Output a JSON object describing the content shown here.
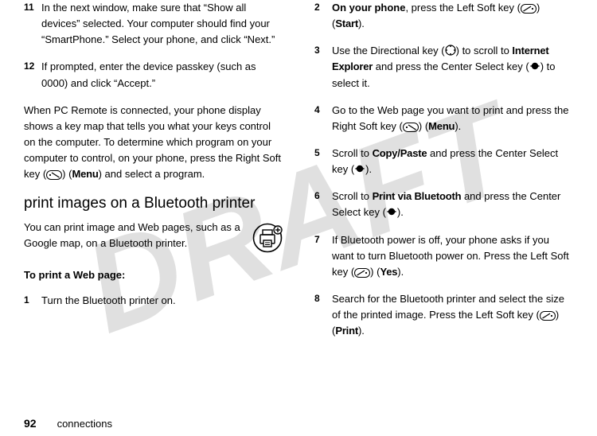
{
  "watermark": "DRAFT",
  "left": {
    "step11": {
      "num": "11",
      "text_a": "In the next window, make sure that “Show all devices” selected. Your computer should find your “SmartPhone.” Select your phone, and click “Next.”"
    },
    "step12": {
      "num": "12",
      "text_a": "If prompted, enter the device passkey (such as 0000) and click “Accept.”"
    },
    "para1_a": "When PC Remote is connected, your phone display shows a key map that tells you what your keys control on the computer. To determine which program on your computer to control, on your phone, press the Right Soft key (",
    "para1_b": ") (",
    "para1_menu": "Menu",
    "para1_c": ") and select a program.",
    "heading": "print images on a Bluetooth printer",
    "intro": "You can print image and Web pages, such as a Google map, on a Bluetooth printer.",
    "lead": "To print a Web page:",
    "step1": {
      "num": "1",
      "text": "Turn the Bluetooth printer on."
    }
  },
  "right": {
    "step2": {
      "num": "2",
      "bold": "On your phone",
      "a": ", press the Left Soft key (",
      "b": ") (",
      "start": "Start",
      "c": ")."
    },
    "step3": {
      "num": "3",
      "a": "Use the Directional key (",
      "b": ") to scroll to ",
      "ie": "Internet Explorer",
      "c": " and press the Center Select key (",
      "d": ") to select it."
    },
    "step4": {
      "num": "4",
      "a": "Go to the Web page you want to print and press the Right Soft key (",
      "b": ") (",
      "menu": "Menu",
      "c": ")."
    },
    "step5": {
      "num": "5",
      "a": "Scroll to ",
      "cp": "Copy/Paste",
      "b": " and press the Center Select key (",
      "c": ")."
    },
    "step6": {
      "num": "6",
      "a": "Scroll to ",
      "pvb": "Print via Bluetooth",
      "b": " and press the Center Select key (",
      "c": ")."
    },
    "step7": {
      "num": "7",
      "a": "If Bluetooth power is off, your phone asks if you want to turn Bluetooth power on. Press the Left Soft key (",
      "b": ") (",
      "yes": "Yes",
      "c": ")."
    },
    "step8": {
      "num": "8",
      "a": "Search for the Bluetooth printer and select the size of the printed image. Press the Left Soft key (",
      "b": ") (",
      "print": "Print",
      "c": ")."
    }
  },
  "footer": {
    "page": "92",
    "section": "connections"
  }
}
